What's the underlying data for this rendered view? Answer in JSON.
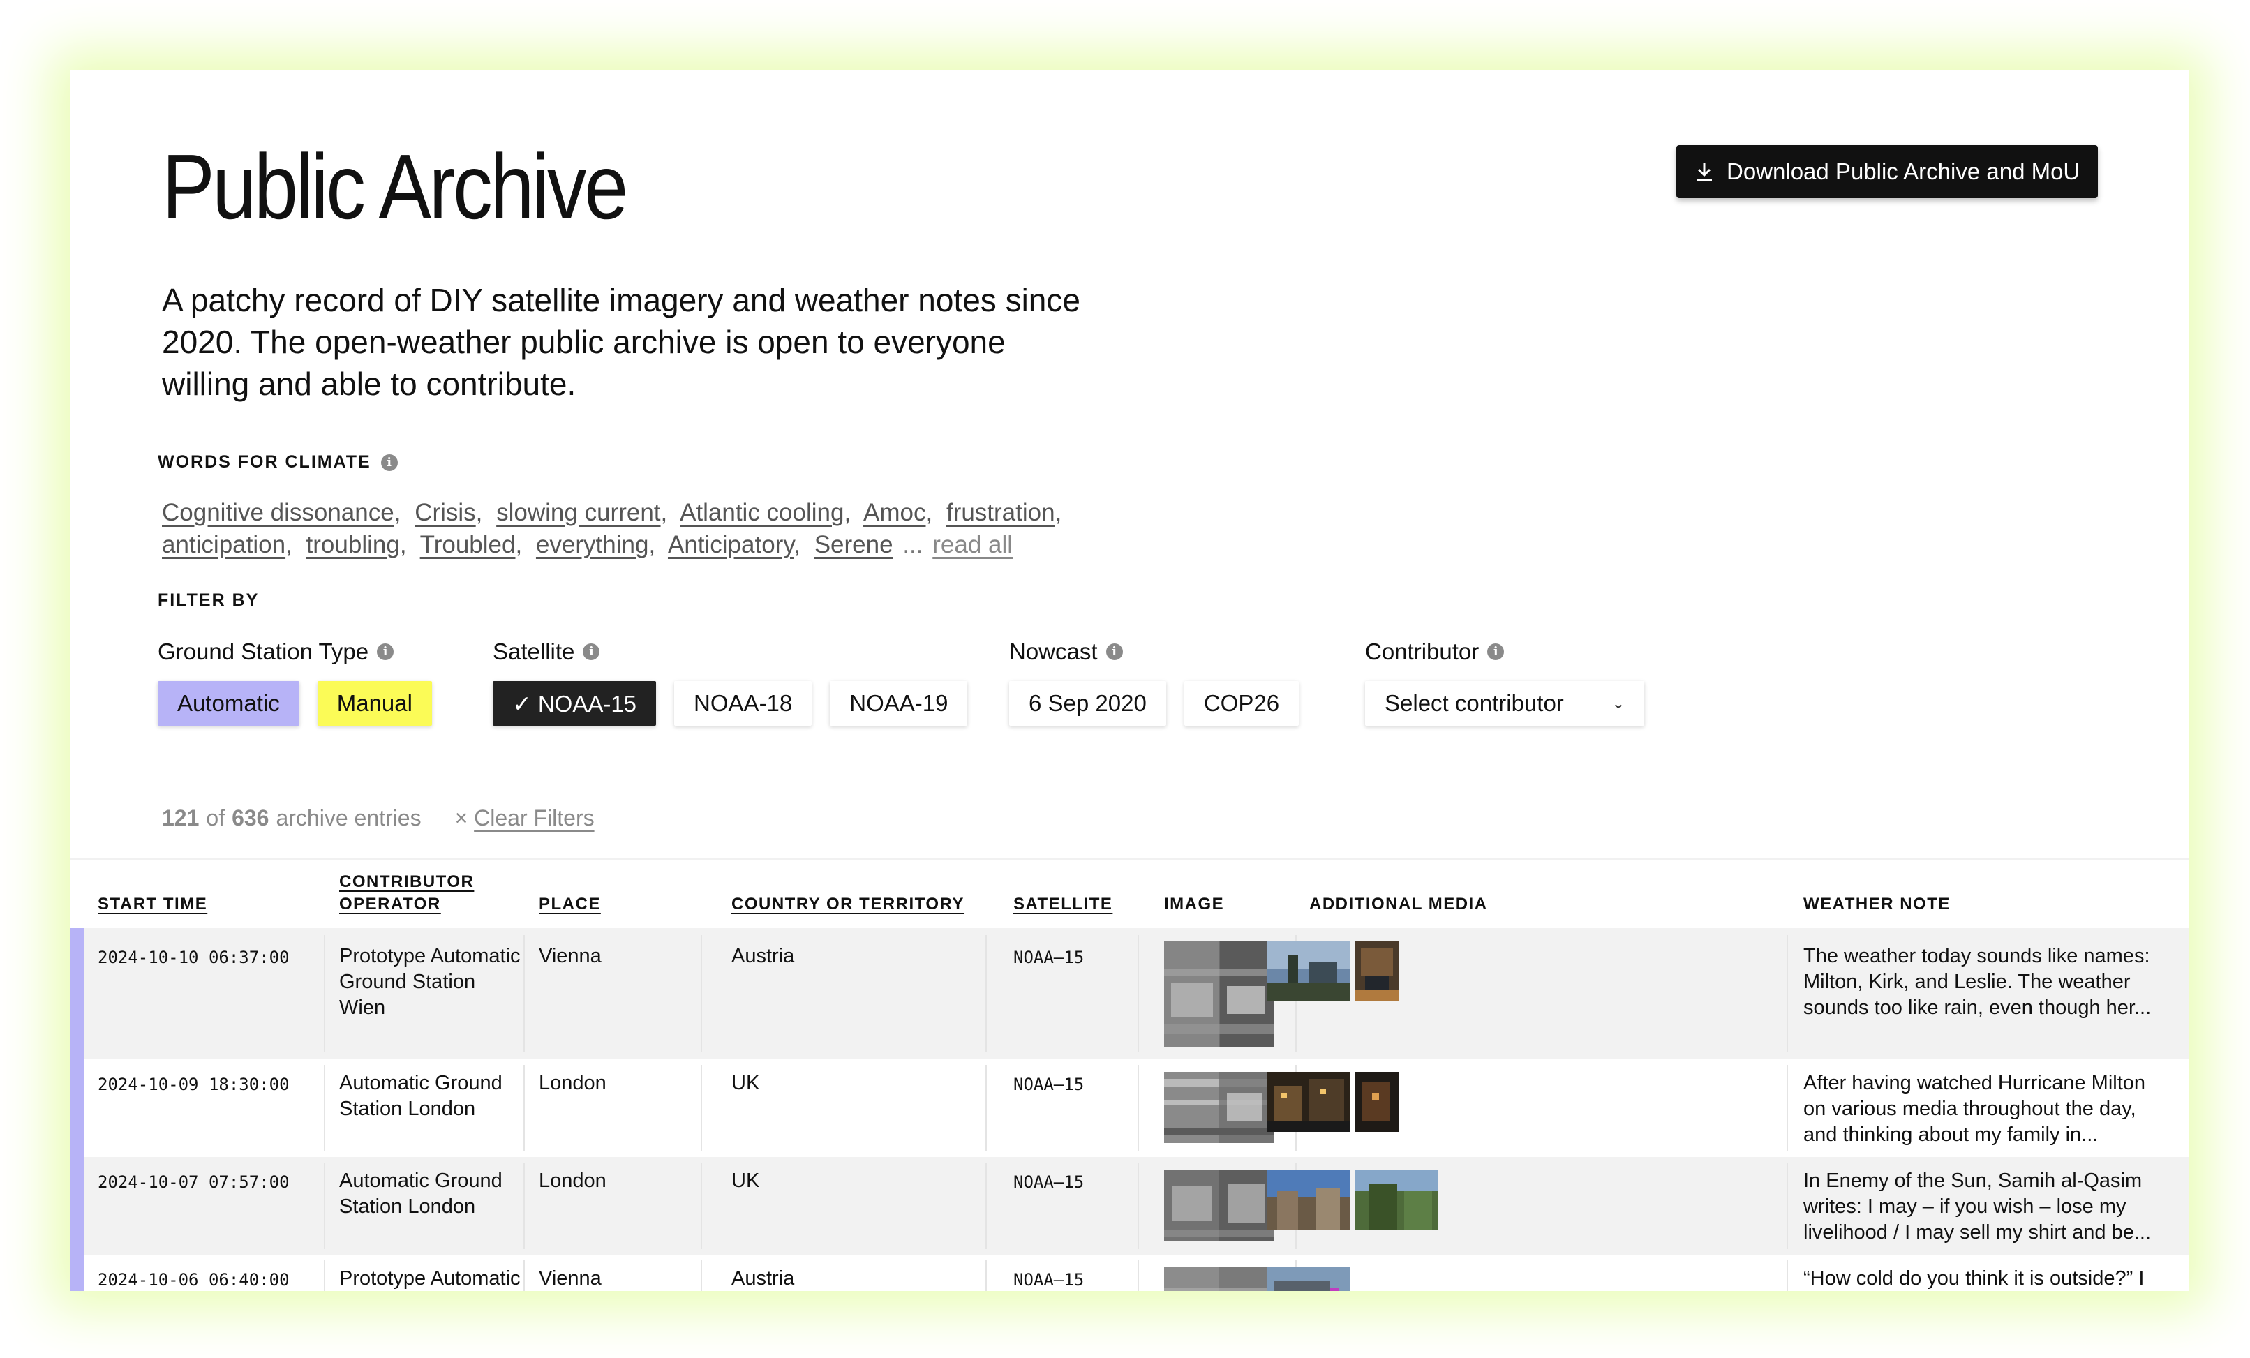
{
  "page": {
    "title": "Public Archive",
    "download_label": "Download Public Archive and MoU",
    "intro": "A patchy record of DIY satellite imagery and weather notes since 2020. The open-weather public archive is open to everyone willing and able to contribute."
  },
  "words_section": {
    "label": "WORDS FOR CLIMATE",
    "words": [
      "Cognitive dissonance",
      "Crisis",
      "slowing current",
      "Atlantic cooling",
      "Amoc",
      "frustration",
      "anticipation",
      "troubling",
      "Troubled",
      "everything",
      "Anticipatory",
      "Serene"
    ],
    "ellipsis": "...",
    "read_all": "read all"
  },
  "filters": {
    "label": "FILTER BY",
    "ground_station": {
      "title": "Ground Station Type",
      "options": [
        "Automatic",
        "Manual"
      ]
    },
    "satellite": {
      "title": "Satellite",
      "options": [
        "✓ NOAA-15",
        "NOAA-18",
        "NOAA-19"
      ]
    },
    "nowcast": {
      "title": "Nowcast",
      "options": [
        "6 Sep 2020",
        "COP26"
      ]
    },
    "contributor": {
      "title": "Contributor",
      "placeholder": "Select contributor"
    }
  },
  "results": {
    "shown": "121",
    "of": "of",
    "total": "636",
    "suffix": "archive entries",
    "clear_x": "×",
    "clear_label": "Clear Filters"
  },
  "table": {
    "headers": {
      "start_time": "START TIME",
      "contributor_line1": "CONTRIBUTOR",
      "contributor_line2": "OPERATOR",
      "place": "PLACE",
      "country": "COUNTRY OR TERRITORY",
      "satellite": "SATELLITE",
      "image": "IMAGE",
      "media": "ADDITIONAL MEDIA",
      "note": "WEATHER NOTE"
    },
    "rows": [
      {
        "start": "2024-10-10 06:37:00",
        "contributor": "Prototype Automatic Ground Station Wien",
        "place": "Vienna",
        "country": "Austria",
        "satellite": "NOAA–15",
        "note": "The weather today sounds like names: Milton, Kirk, and Leslie. The weather sounds too like rain, even though her..."
      },
      {
        "start": "2024-10-09 18:30:00",
        "contributor": "Automatic Ground Station London",
        "place": "London",
        "country": "UK",
        "satellite": "NOAA–15",
        "note": "After having watched Hurricane Milton on various media throughout the day, and thinking about my family in..."
      },
      {
        "start": "2024-10-07 07:57:00",
        "contributor": "Automatic Ground Station London",
        "place": "London",
        "country": "UK",
        "satellite": "NOAA–15",
        "note": "In Enemy of the Sun, Samih al-Qasim writes: I may – if you wish – lose my livelihood / I may sell my shirt and be..."
      },
      {
        "start": "2024-10-06 06:40:00",
        "contributor": "Prototype Automatic Ground Station Wien",
        "place": "Vienna",
        "country": "Austria",
        "satellite": "NOAA–15",
        "note": "“How cold do you think it is outside?” I ask N as I hesitate between a light"
      }
    ]
  },
  "colors": {
    "automatic": "#b7b3f7",
    "manual": "#fbfb57",
    "active": "#222222",
    "row_marker": "#b7b3f7",
    "glow": "#eafdb8"
  }
}
